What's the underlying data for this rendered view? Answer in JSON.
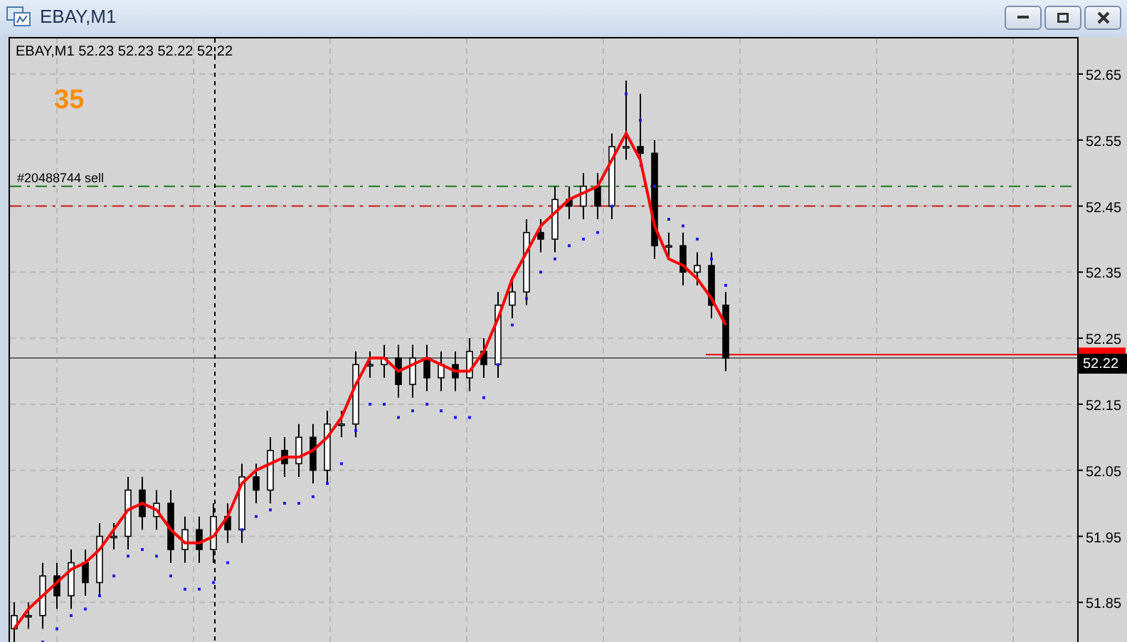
{
  "window": {
    "title": "EBAY,M1"
  },
  "chart": {
    "symbol": "EBAY,M1",
    "ohlc": "52.23 52.23 52.22 52.22",
    "indicator_value": "35",
    "order_label": "#20488744 sell",
    "price_tag": "52.22",
    "chart_data": {
      "type": "candlestick",
      "grid": true,
      "ylim": [
        51.79,
        52.706
      ],
      "yticks": [
        {
          "value": 52.65,
          "label": "52.65"
        },
        {
          "value": 52.55,
          "label": "52.55"
        },
        {
          "value": 52.45,
          "label": "52.45"
        },
        {
          "value": 52.35,
          "label": "52.35"
        },
        {
          "value": 52.25,
          "label": "52.25"
        },
        {
          "value": 52.15,
          "label": "52.15"
        },
        {
          "value": 52.05,
          "label": "52.05"
        },
        {
          "value": 51.95,
          "label": "51.95"
        },
        {
          "value": 51.85,
          "label": "51.85"
        }
      ],
      "ohlc": [
        [
          51.81,
          51.85,
          51.79,
          51.83
        ],
        [
          51.83,
          51.85,
          51.81,
          51.83
        ],
        [
          51.83,
          51.91,
          51.81,
          51.89
        ],
        [
          51.89,
          51.91,
          51.84,
          51.86
        ],
        [
          51.86,
          51.93,
          51.84,
          51.91
        ],
        [
          51.91,
          51.93,
          51.86,
          51.88
        ],
        [
          51.88,
          51.97,
          51.86,
          51.95
        ],
        [
          51.95,
          51.97,
          51.93,
          51.95
        ],
        [
          51.95,
          52.04,
          51.93,
          52.02
        ],
        [
          52.02,
          52.04,
          51.96,
          51.98
        ],
        [
          51.98,
          52.02,
          51.96,
          52.0
        ],
        [
          52.0,
          52.02,
          51.91,
          51.93
        ],
        [
          51.93,
          51.98,
          51.91,
          51.96
        ],
        [
          51.96,
          51.98,
          51.91,
          51.93
        ],
        [
          51.93,
          52.0,
          51.91,
          51.98
        ],
        [
          51.98,
          52.0,
          51.94,
          51.96
        ],
        [
          51.96,
          52.06,
          51.94,
          52.04
        ],
        [
          52.04,
          52.06,
          52.0,
          52.02
        ],
        [
          52.02,
          52.1,
          52.0,
          52.08
        ],
        [
          52.08,
          52.1,
          52.04,
          52.06
        ],
        [
          52.06,
          52.12,
          52.04,
          52.1
        ],
        [
          52.1,
          52.12,
          52.03,
          52.05
        ],
        [
          52.05,
          52.14,
          52.03,
          52.12
        ],
        [
          52.12,
          52.14,
          52.1,
          52.12
        ],
        [
          52.12,
          52.23,
          52.1,
          52.21
        ],
        [
          52.21,
          52.23,
          52.19,
          52.21
        ],
        [
          52.21,
          52.24,
          52.19,
          52.22
        ],
        [
          52.22,
          52.24,
          52.16,
          52.18
        ],
        [
          52.18,
          52.24,
          52.16,
          52.22
        ],
        [
          52.22,
          52.24,
          52.17,
          52.19
        ],
        [
          52.19,
          52.23,
          52.17,
          52.21
        ],
        [
          52.21,
          52.23,
          52.17,
          52.19
        ],
        [
          52.19,
          52.25,
          52.17,
          52.23
        ],
        [
          52.23,
          52.25,
          52.19,
          52.21
        ],
        [
          52.21,
          52.32,
          52.19,
          52.3
        ],
        [
          52.3,
          52.34,
          52.28,
          52.32
        ],
        [
          52.32,
          52.43,
          52.3,
          52.41
        ],
        [
          52.41,
          52.43,
          52.38,
          52.4
        ],
        [
          52.4,
          52.48,
          52.38,
          52.46
        ],
        [
          52.46,
          52.48,
          52.43,
          52.45
        ],
        [
          52.45,
          52.5,
          52.43,
          52.48
        ],
        [
          52.48,
          52.5,
          52.43,
          52.45
        ],
        [
          52.45,
          52.56,
          52.43,
          52.54
        ],
        [
          52.54,
          52.64,
          52.52,
          52.54
        ],
        [
          52.54,
          52.62,
          52.51,
          52.53
        ],
        [
          52.53,
          52.55,
          52.37,
          52.39
        ],
        [
          52.39,
          52.41,
          52.37,
          52.39
        ],
        [
          52.39,
          52.41,
          52.33,
          52.35
        ],
        [
          52.35,
          52.38,
          52.33,
          52.36
        ],
        [
          52.36,
          52.38,
          52.28,
          52.3
        ],
        [
          52.3,
          52.32,
          52.2,
          52.22
        ]
      ],
      "series": [
        {
          "type": "line",
          "color": "#ff0000",
          "values": [
            51.81,
            51.84,
            51.86,
            51.88,
            51.9,
            51.91,
            51.93,
            51.96,
            51.99,
            52.0,
            51.99,
            51.96,
            51.94,
            51.94,
            51.95,
            51.98,
            52.03,
            52.05,
            52.06,
            52.07,
            52.07,
            52.08,
            52.1,
            52.13,
            52.18,
            52.22,
            52.22,
            52.2,
            52.21,
            52.22,
            52.21,
            52.2,
            52.2,
            52.23,
            52.28,
            52.34,
            52.38,
            52.42,
            52.44,
            52.46,
            52.47,
            52.48,
            52.52,
            52.56,
            52.52,
            52.42,
            52.37,
            52.36,
            52.34,
            52.31,
            52.27
          ]
        },
        {
          "type": "scatter",
          "color": "#1e1ee6",
          "values": [
            null,
            null,
            51.79,
            51.81,
            51.83,
            51.84,
            51.86,
            51.89,
            51.92,
            51.93,
            51.92,
            51.89,
            51.87,
            51.87,
            51.88,
            51.91,
            51.96,
            51.98,
            51.99,
            52.0,
            52.0,
            52.01,
            52.03,
            52.06,
            52.11,
            52.15,
            52.15,
            52.13,
            52.14,
            52.15,
            52.14,
            52.13,
            52.13,
            52.16,
            52.21,
            52.27,
            52.31,
            52.35,
            52.37,
            52.39,
            52.4,
            52.41,
            52.45,
            52.62,
            52.58,
            52.48,
            52.43,
            52.42,
            52.4,
            52.37,
            52.33
          ]
        }
      ],
      "ref_lines": [
        {
          "axis": "y",
          "value": 52.48,
          "color": "#1a7a1a"
        },
        {
          "axis": "y",
          "value": 52.45,
          "color": "#cc1a1a"
        },
        {
          "axis": "y",
          "value": 52.22,
          "color": "#666666"
        }
      ]
    }
  }
}
